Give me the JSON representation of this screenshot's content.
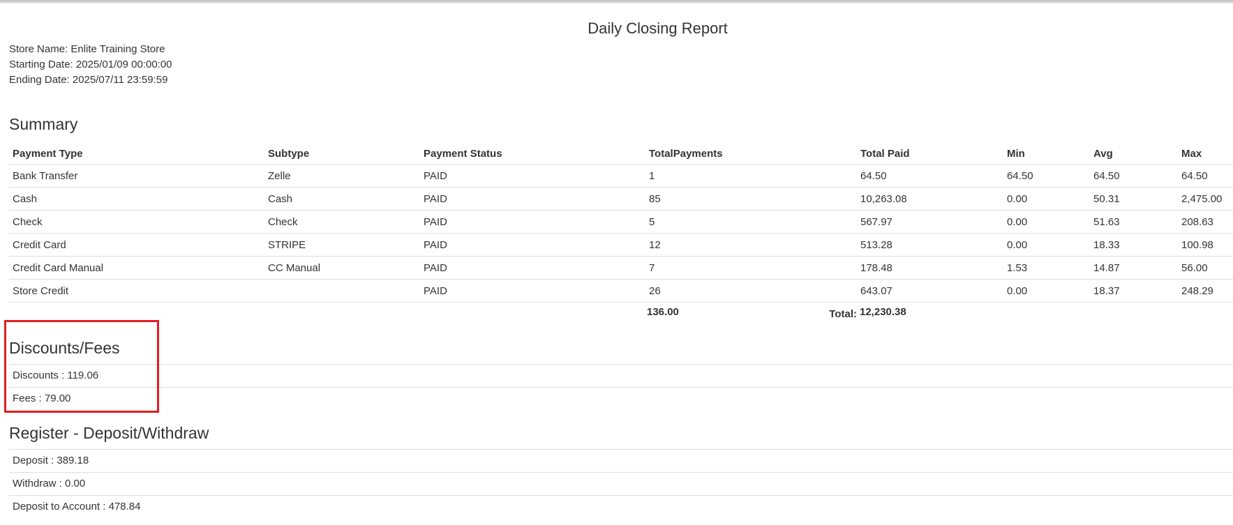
{
  "report": {
    "title": "Daily Closing Report",
    "store_name": "Store Name: Enlite Training Store",
    "starting_date": "Starting Date: 2025/01/09 00:00:00",
    "ending_date": "Ending Date: 2025/07/11 23:59:59"
  },
  "summary": {
    "title": "Summary",
    "headers": [
      "Payment Type",
      "Subtype",
      "Payment Status",
      "TotalPayments",
      "Total Paid",
      "Min",
      "Avg",
      "Max"
    ],
    "rows": [
      [
        "Bank Transfer",
        "Zelle",
        "PAID",
        "1",
        "64.50",
        "64.50",
        "64.50",
        "64.50"
      ],
      [
        "Cash",
        "Cash",
        "PAID",
        "85",
        "10,263.08",
        "0.00",
        "50.31",
        "2,475.00"
      ],
      [
        "Check",
        "Check",
        "PAID",
        "5",
        "567.97",
        "0.00",
        "51.63",
        "208.63"
      ],
      [
        "Credit Card",
        "STRIPE",
        "PAID",
        "12",
        "513.28",
        "0.00",
        "18.33",
        "100.98"
      ],
      [
        "Credit Card Manual",
        "CC Manual",
        "PAID",
        "7",
        "178.48",
        "1.53",
        "14.87",
        "56.00"
      ],
      [
        "Store Credit",
        "",
        "PAID",
        "26",
        "643.07",
        "0.00",
        "18.37",
        "248.29"
      ]
    ],
    "total_label": "Total:",
    "total_payments": "136.00",
    "total_paid": "12,230.38"
  },
  "discounts_fees": {
    "title": "Discounts/Fees",
    "discounts": "Discounts : 119.06",
    "fees": "Fees : 79.00"
  },
  "register": {
    "title": "Register - Deposit/Withdraw",
    "deposit": "Deposit : 389.18",
    "withdraw": "Withdraw : 0.00",
    "deposit_to_account": "Deposit to Account : 478.84"
  },
  "colors": {
    "highlight": "#e01e1e",
    "divider": "#dddddd",
    "text": "#333333"
  }
}
